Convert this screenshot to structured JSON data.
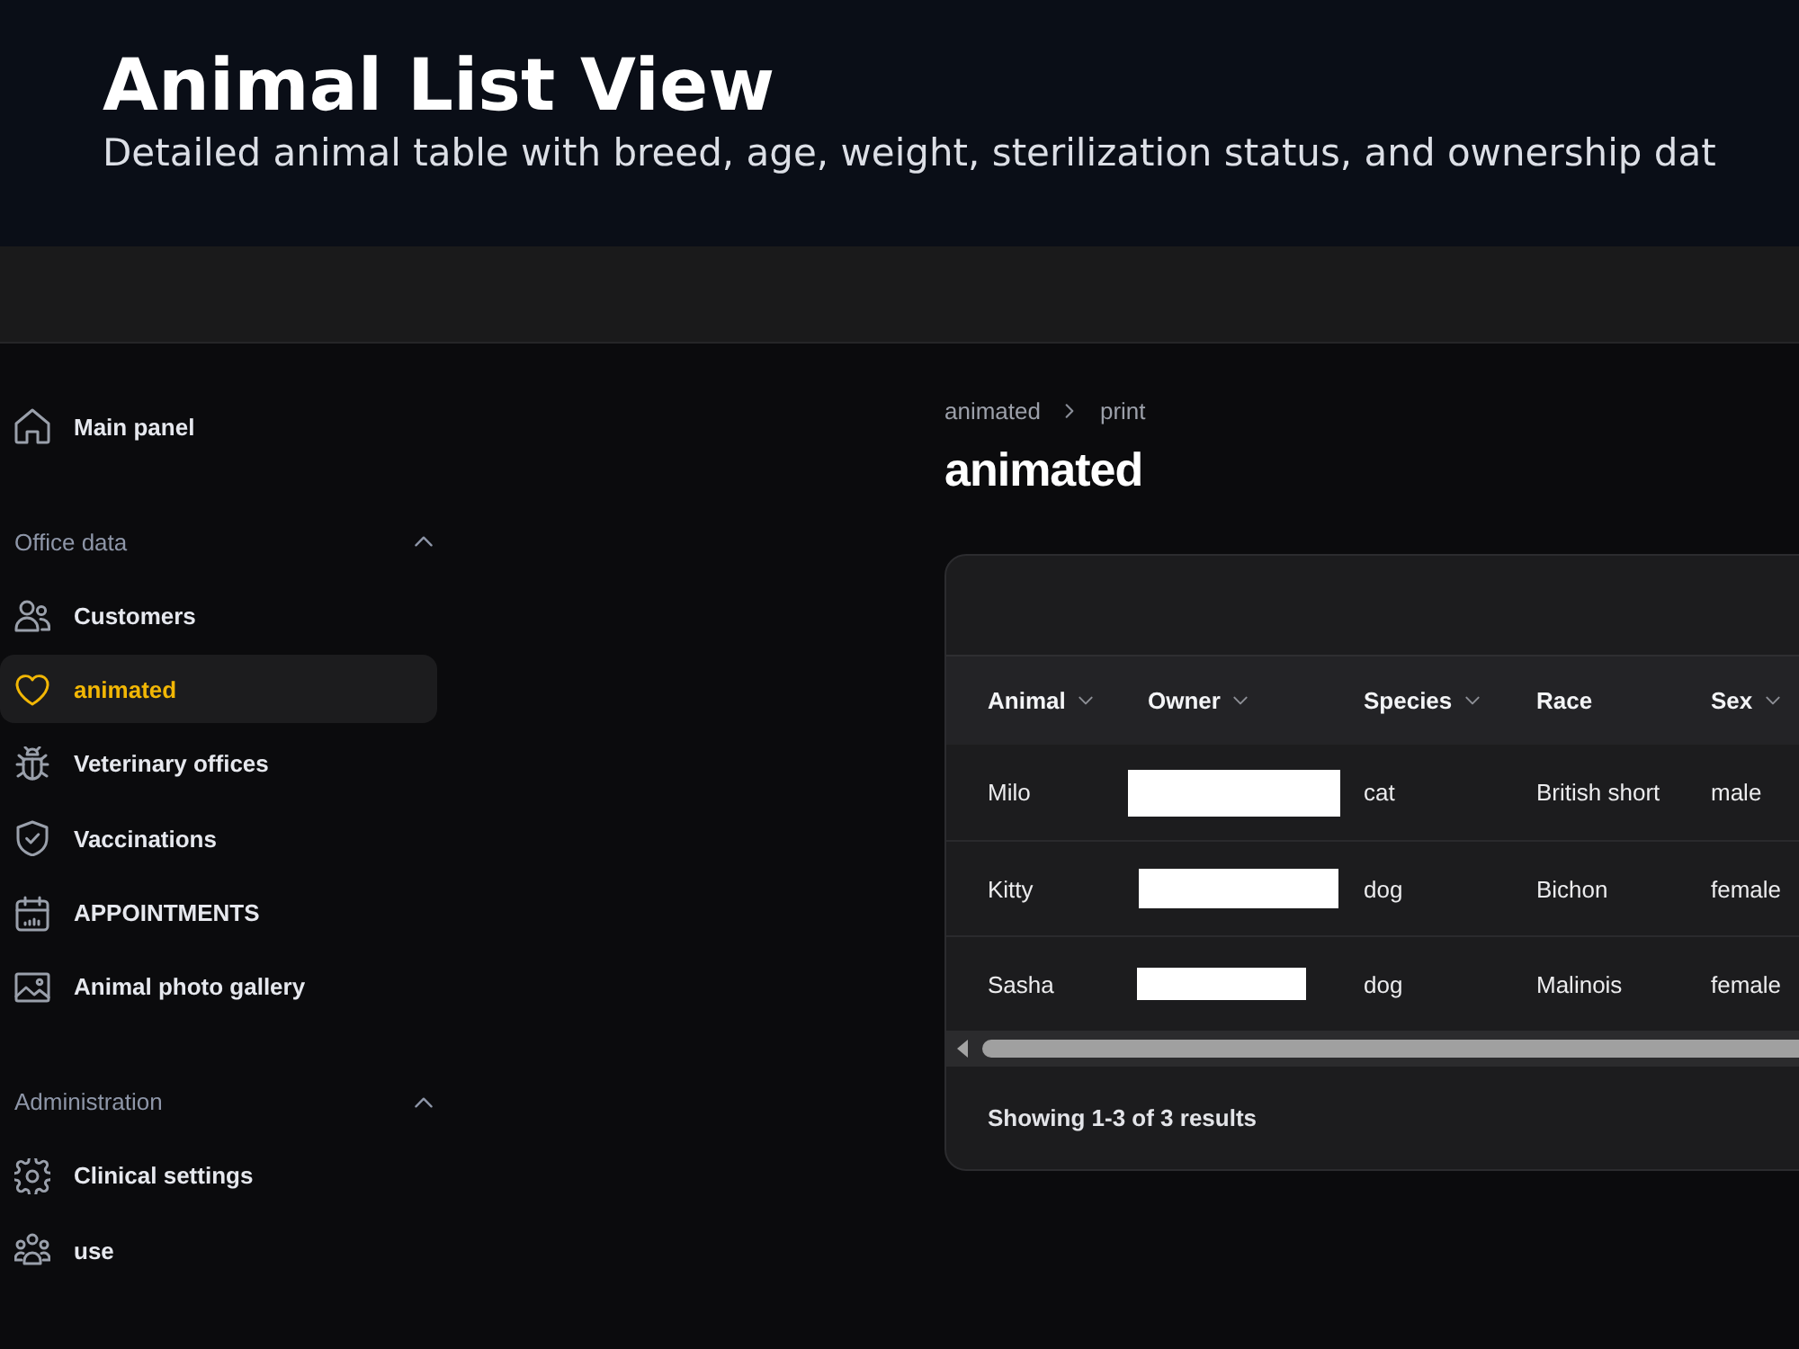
{
  "header": {
    "title": "Animal List View",
    "subtitle": "Detailed animal table with breed, age, weight, sterilization status, and ownership dat"
  },
  "sidebar": {
    "items": [
      {
        "label": "Main panel",
        "selected": false
      }
    ],
    "sections": [
      {
        "title": "Office data",
        "expanded": true,
        "items": [
          {
            "label": "Customers",
            "selected": false
          },
          {
            "label": "animated",
            "selected": true
          },
          {
            "label": "Veterinary offices",
            "selected": false
          },
          {
            "label": "Vaccinations",
            "selected": false
          },
          {
            "label": "APPOINTMENTS",
            "selected": false
          },
          {
            "label": "Animal photo gallery",
            "selected": false
          }
        ]
      },
      {
        "title": "Administration",
        "expanded": true,
        "items": [
          {
            "label": "Clinical settings",
            "selected": false
          },
          {
            "label": "use",
            "selected": false
          }
        ]
      }
    ]
  },
  "breadcrumb": [
    "animated",
    "print"
  ],
  "page_title": "animated",
  "table": {
    "columns": [
      {
        "label": "Animal",
        "sortable": true
      },
      {
        "label": "Owner",
        "sortable": true
      },
      {
        "label": "Species",
        "sortable": true
      },
      {
        "label": "Race",
        "sortable": false
      },
      {
        "label": "Sex",
        "sortable": true
      }
    ],
    "rows": [
      {
        "cells": [
          {
            "text": "Milo"
          },
          {
            "redacted": true
          },
          {
            "text": "cat"
          },
          {
            "text": "British short"
          },
          {
            "text": "male"
          }
        ]
      },
      {
        "cells": [
          {
            "text": "Kitty"
          },
          {
            "redacted": true
          },
          {
            "text": "dog"
          },
          {
            "text": "Bichon"
          },
          {
            "text": "female"
          }
        ]
      },
      {
        "cells": [
          {
            "text": "Sasha"
          },
          {
            "redacted": true
          },
          {
            "text": "dog"
          },
          {
            "text": "Malinois"
          },
          {
            "text": "female"
          }
        ]
      }
    ],
    "summary": "Showing 1-3 of 3 results"
  }
}
